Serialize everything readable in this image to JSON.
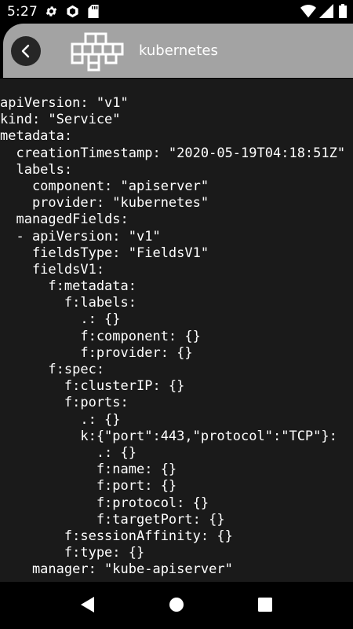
{
  "status_bar": {
    "time": "5:27",
    "left_icons": [
      "gear-icon",
      "hexagon-app-icon",
      "sd-card-icon"
    ],
    "right_icons": [
      "wifi-icon",
      "cellular-signal-icon",
      "battery-icon"
    ]
  },
  "app_bar": {
    "title": "kubernetes",
    "logo_icon": "kubernetes-blocks-logo-icon",
    "back_icon": "chevron-left-icon"
  },
  "yaml": {
    "lines": [
      "apiVersion: \"v1\"",
      "kind: \"Service\"",
      "metadata:",
      "  creationTimestamp: \"2020-05-19T04:18:51Z\"",
      "  labels:",
      "    component: \"apiserver\"",
      "    provider: \"kubernetes\"",
      "  managedFields:",
      "  - apiVersion: \"v1\"",
      "    fieldsType: \"FieldsV1\"",
      "    fieldsV1:",
      "      f:metadata:",
      "        f:labels:",
      "          .: {}",
      "          f:component: {}",
      "          f:provider: {}",
      "      f:spec:",
      "        f:clusterIP: {}",
      "        f:ports:",
      "          .: {}",
      "          k:{\"port\":443,\"protocol\":\"TCP\"}:",
      "            .: {}",
      "            f:name: {}",
      "            f:port: {}",
      "            f:protocol: {}",
      "            f:targetPort: {}",
      "        f:sessionAffinity: {}",
      "        f:type: {}",
      "    manager: \"kube-apiserver\""
    ]
  },
  "nav_bar": {
    "icons": [
      "back-triangle-icon",
      "home-circle-icon",
      "recents-square-icon"
    ]
  },
  "colors": {
    "app_bar": "#a3a3a3",
    "content_bg": "#1a1a1a",
    "text": "#ffffff"
  }
}
